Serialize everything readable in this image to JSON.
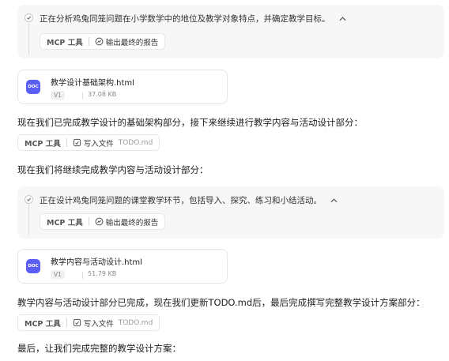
{
  "steps": [
    {
      "text": "正在分析鸡兔同笼问题在小学数学中的地位及教学对象特点，并确定教学目标。",
      "chip": {
        "mcp": "MCP 工具",
        "action": "输出最终的报告"
      }
    },
    {
      "text": "正在设计鸡兔同笼问题的课堂教学环节，包括导入、探究、练习和小结活动。",
      "chip": {
        "mcp": "MCP 工具",
        "action": "输出最终的报告"
      }
    }
  ],
  "docs": [
    {
      "icon_text": "DOC",
      "name": "教学设计基础架构.html",
      "version": "V1",
      "size": "37.08 KB"
    },
    {
      "icon_text": "DOC",
      "name": "教学内容与活动设计.html",
      "version": "V1",
      "size": "51.79 KB"
    }
  ],
  "paragraphs": [
    "现在我们已完成教学设计的基础架构部分，接下来继续进行教学内容与活动设计部分：",
    "现在我们将继续完成教学内容与活动设计部分：",
    "教学内容与活动设计部分已完成，现在我们更新TODO.md后，最后完成撰写完整教学设计方案部分：",
    "最后，让我们完成完整的教学设计方案："
  ],
  "write_chips": [
    {
      "mcp": "MCP 工具",
      "action": "写入文件",
      "file": "TODO.md"
    },
    {
      "mcp": "MCP 工具",
      "action": "写入文件",
      "file": "TODO.md"
    }
  ],
  "icons": {
    "step_check": "check-circle-icon",
    "collapse": "chevron-up-icon",
    "report": "report-icon",
    "write": "write-file-icon",
    "doc": "doc-file-icon"
  }
}
